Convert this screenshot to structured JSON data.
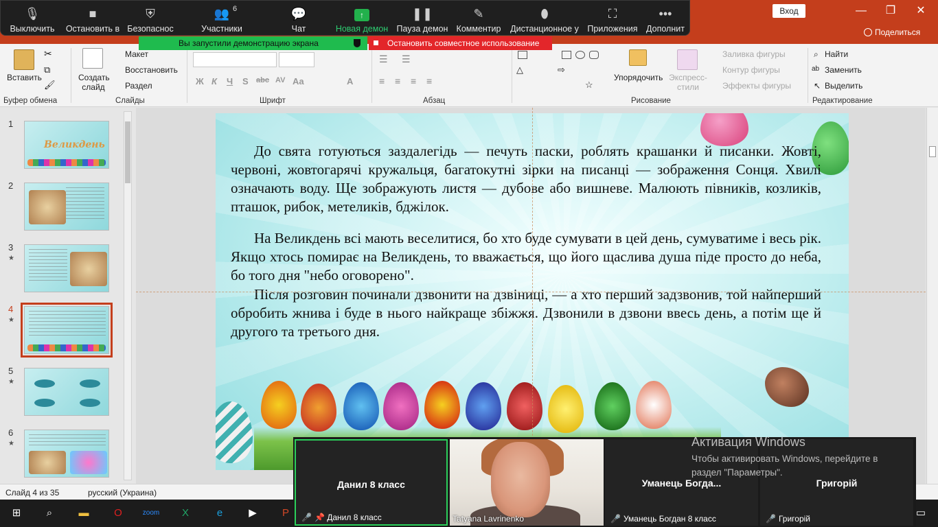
{
  "window": {
    "login_label": "Вход",
    "share_label": "Поделиться"
  },
  "zoom_toolbar": {
    "items": [
      {
        "label": "Выключить",
        "icon": "mic-icon"
      },
      {
        "label": "Остановить в",
        "icon": "video-icon"
      },
      {
        "label": "Безопаснос",
        "icon": "shield-icon"
      },
      {
        "label": "Участники",
        "icon": "participants-icon",
        "count": "6"
      },
      {
        "label": "Чат",
        "icon": "chat-icon"
      },
      {
        "label": "Новая демон",
        "icon": "share-screen-icon"
      },
      {
        "label": "Пауза демон",
        "icon": "pause-icon"
      },
      {
        "label": "Комментир",
        "icon": "annotate-icon"
      },
      {
        "label": "Дистанционное у",
        "icon": "remote-control-icon"
      },
      {
        "label": "Приложения",
        "icon": "apps-icon"
      },
      {
        "label": "Дополнит",
        "icon": "more-icon"
      }
    ],
    "share_banner": "Вы запустили демонстрацию экрана",
    "stop_share": "Остановить совместное использование"
  },
  "ribbon": {
    "clipboard": {
      "paste": "Вставить",
      "label": "Буфер обмена"
    },
    "slides": {
      "new_slide": "Создать слайд",
      "layout": "Макет",
      "reset": "Восстановить",
      "section": "Раздел",
      "label": "Слайды"
    },
    "font": {
      "label": "Шрифт",
      "format_buttons": [
        "Ж",
        "К",
        "Ч",
        "S",
        "abc",
        "AV",
        "Aa",
        "A"
      ]
    },
    "paragraph": {
      "label": "Абзац"
    },
    "drawing": {
      "arrange": "Упорядочить",
      "quick_styles": "Экспресс-стили",
      "fill": "Заливка фигуры",
      "outline": "Контур фигуры",
      "effects": "Эффекты фигуры",
      "label": "Рисование"
    },
    "editing": {
      "find": "Найти",
      "replace": "Заменить",
      "select": "Выделить",
      "label": "Редактирование"
    }
  },
  "thumbnails": [
    {
      "num": "1",
      "star": false,
      "title": "Великдень"
    },
    {
      "num": "2",
      "star": false
    },
    {
      "num": "3",
      "star": true
    },
    {
      "num": "4",
      "star": true,
      "selected": true
    },
    {
      "num": "5",
      "star": true
    },
    {
      "num": "6",
      "star": true
    }
  ],
  "slide": {
    "para1": "До свята готуються заздалегідь — печуть паски, роблять крашанки й писанки. Жовті, червоні, жовтогарячі кружальця, багатокутні зірки на писанці — зображення Сонця. Хвилі означають воду. Ще зображують листя — дубове або вишневе. Малюють півників, козликів, пташок, рибок, метеликів, бджілок.",
    "para2": "На Великдень всі мають веселитися, бо хто буде сумувати в цей день, сумуватиме  і весь рік. Якщо хтось помирає на Великдень, то вважається, що його щаслива душа піде просто до неба, бо того дня \"небо оговорено\".",
    "para3": "Після розговин починали дзвонити на дзвіниці, — а хто перший задзвонив, той найперший обробить жнива і буде в нього найкраще збіжжя. Дзвонили в дзвони ввесь день, а потім ще й другого та третього дня."
  },
  "status": {
    "slide_of": "Слайд 4 из 35",
    "language": "русский (Украина)"
  },
  "gallery": [
    {
      "display_name": "Данил 8 класс",
      "footer": "Данил 8 класс",
      "active": true
    },
    {
      "display_name": "",
      "footer": "Tatyana Lavrinenko",
      "video": true
    },
    {
      "display_name": "Уманець  Богда...",
      "footer": "Уманець Богдан 8 класс"
    },
    {
      "display_name": "Григорій",
      "footer": "Григорій"
    }
  ],
  "activation": {
    "title": "Активация Windows",
    "text": "Чтобы активировать Windows, перейдите в раздел \"Параметры\"."
  }
}
